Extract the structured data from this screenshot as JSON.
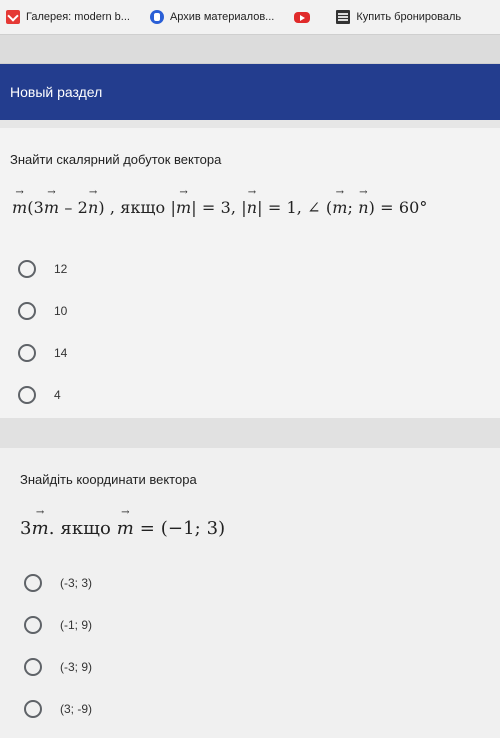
{
  "bookmarks": [
    {
      "label": "Галерея: modern b...",
      "icon": "gallery-icon"
    },
    {
      "label": "Архив материалов...",
      "icon": "archive-icon"
    },
    {
      "label": "",
      "icon": "youtube-icon"
    },
    {
      "label": "Купить бронироваль",
      "icon": "buy-icon"
    }
  ],
  "section": {
    "title": "Новый раздел",
    "color": "#233d8e"
  },
  "q1": {
    "title": "Знайти скалярний добуток вектора",
    "formula": {
      "part1": "(3",
      "part2": " – 2",
      "part3": ")",
      "conj": " , якщо |",
      "cond1": "| = 3,  |",
      "cond2": "| = 1,  ∠ (",
      "sep": "; ",
      "end": ") = 60°",
      "m": "m",
      "n": "n"
    },
    "options": [
      "12",
      "10",
      "14",
      "4"
    ]
  },
  "q2": {
    "title": "Знайдіть координати вектора",
    "formula": {
      "lead": "3",
      "mid": ". якщо ",
      "end": " = (−1; 3)",
      "m": "m"
    },
    "options": [
      "(-3; 3)",
      "(-1; 9)",
      "(-3; 9)",
      "(3; -9)"
    ]
  }
}
